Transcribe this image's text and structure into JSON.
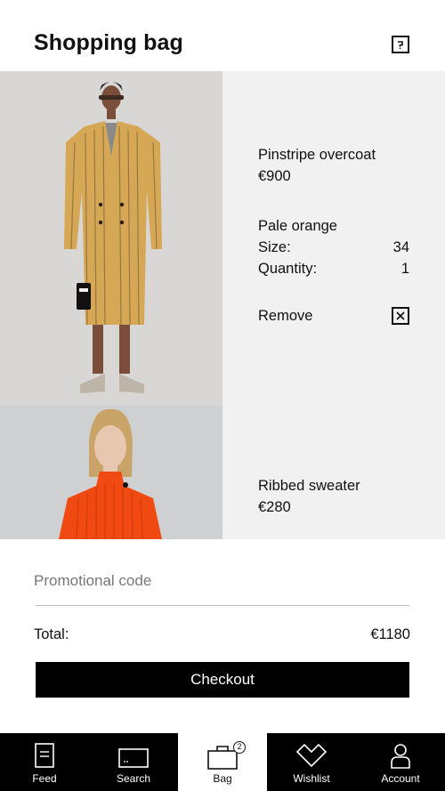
{
  "header": {
    "title": "Shopping bag",
    "help_icon": "help-square-icon"
  },
  "items": [
    {
      "name": "Pinstripe overcoat",
      "price": "€900",
      "color": "Pale orange",
      "size_label": "Size:",
      "size_value": "34",
      "quantity_label": "Quantity:",
      "quantity_value": "1",
      "remove_label": "Remove"
    },
    {
      "name": "Ribbed sweater",
      "price": "€280"
    }
  ],
  "promo": {
    "placeholder": "Promotional code"
  },
  "summary": {
    "total_label": "Total:",
    "total_value": "€1180"
  },
  "checkout_label": "Checkout",
  "nav": [
    {
      "label": "Feed",
      "icon": "feed-icon"
    },
    {
      "label": "Search",
      "icon": "search-icon"
    },
    {
      "label": "Bag",
      "icon": "bag-icon",
      "badge": "2",
      "active": true
    },
    {
      "label": "Wishlist",
      "icon": "wishlist-icon"
    },
    {
      "label": "Account",
      "icon": "account-icon"
    }
  ]
}
